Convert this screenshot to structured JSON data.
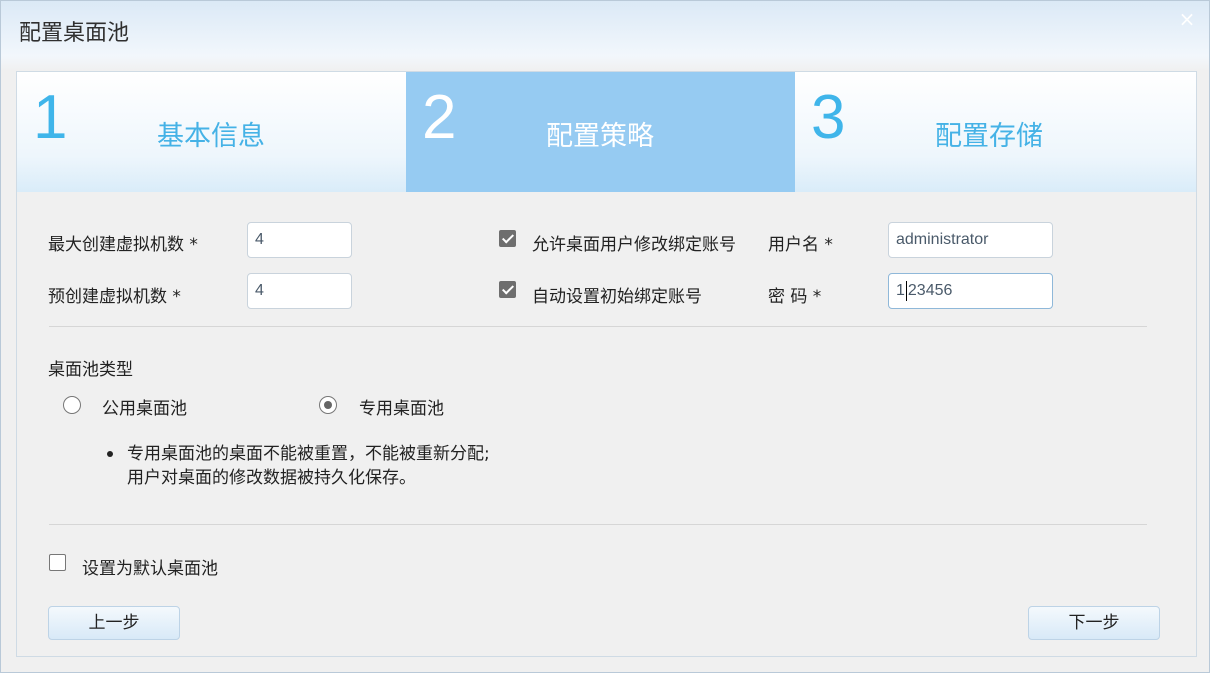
{
  "dialog": {
    "title": "配置桌面池",
    "close_glyph": "×"
  },
  "steps": [
    {
      "number": "1",
      "label": "基本信息",
      "active": false
    },
    {
      "number": "2",
      "label": "配置策略",
      "active": true
    },
    {
      "number": "3",
      "label": "配置存储",
      "active": false
    }
  ],
  "form": {
    "max_vm": {
      "label": "最大创建虚拟机数 *",
      "value": "4"
    },
    "pre_vm": {
      "label": "预创建虚拟机数 *",
      "value": "4"
    },
    "allow_modify": {
      "label": "允许桌面用户修改绑定账号",
      "checked": true
    },
    "auto_bind": {
      "label": "自动设置初始绑定账号",
      "checked": true
    },
    "username": {
      "label": "用户名 *",
      "value": "administrator"
    },
    "password": {
      "label": "密 码 *",
      "value_before_caret": "1",
      "value_after_caret": "23456"
    }
  },
  "pool_type": {
    "label": "桌面池类型",
    "options": [
      {
        "label": "公用桌面池",
        "checked": false
      },
      {
        "label": "专用桌面池",
        "checked": true
      }
    ],
    "description_line1": "专用桌面池的桌面不能被重置，不能被重新分配;",
    "description_line2": "用户对桌面的修改数据被持久化保存。"
  },
  "default_pool": {
    "label": "设置为默认桌面池",
    "checked": false
  },
  "buttons": {
    "prev": "上一步",
    "next": "下一步"
  }
}
